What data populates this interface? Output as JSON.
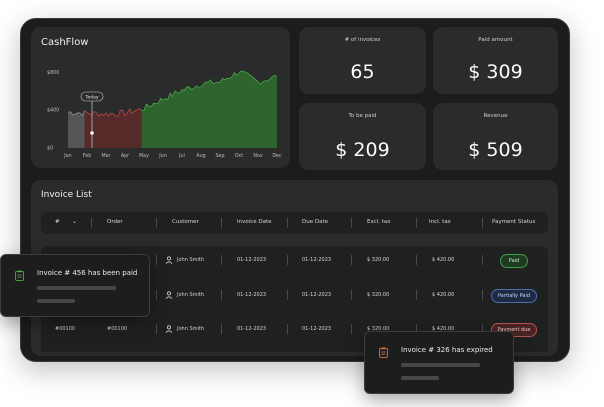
{
  "cashflow": {
    "title": "CashFlow",
    "today_label": "Today"
  },
  "stats": {
    "invoices_label": "# of invoices",
    "invoices_value": "65",
    "paid_label": "Paid amount",
    "paid_value": "$ 309",
    "tobepaid_label": "To be paid",
    "tobepaid_value": "$ 209",
    "revenue_label": "Revenue",
    "revenue_value": "$ 509"
  },
  "invoice_list": {
    "title": "Invoice List",
    "columns": [
      "#",
      "Order",
      "Customer",
      "Invoice Date",
      "Due Date",
      "Excl. tax",
      "Incl. tax",
      "Payment Status"
    ],
    "rows": [
      {
        "num": "",
        "order": "",
        "customer": "John Smith",
        "invoice_date": "01-12-2023",
        "due_date": "01-12-2023",
        "excl": "$ 320.00",
        "incl": "$ 420.00",
        "status": "Paid"
      },
      {
        "num": "",
        "order": "",
        "customer": "John Smith",
        "invoice_date": "01-12-2023",
        "due_date": "01-12-2023",
        "excl": "$ 320.00",
        "incl": "$ 420.00",
        "status": "Partially Paid"
      },
      {
        "num": "#00100",
        "order": "#00100",
        "customer": "John Smith",
        "invoice_date": "01-12-2023",
        "due_date": "01-12-2023",
        "excl": "$ 320.00",
        "incl": "$ 420.00",
        "status": "Payment due"
      }
    ]
  },
  "toasts": {
    "paid_message": "Invoice # 456 has been paid",
    "expired_message": "Invoice # 326 has expired"
  },
  "colors": {
    "accent_green": "#3f9e4a",
    "accent_red": "#c0504d",
    "card_bg": "#2a2b2b"
  },
  "chart_data": {
    "type": "area",
    "title": "CashFlow",
    "categories": [
      "Jan",
      "Feb",
      "Mar",
      "Apr",
      "May",
      "Jun",
      "Jul",
      "Aug",
      "Sep",
      "Oct",
      "Nov",
      "Dec"
    ],
    "y_ticks": [
      "$800",
      "$400",
      "$0"
    ],
    "ylim": [
      0,
      900
    ],
    "today_category": "Feb",
    "series": [
      {
        "values": [
          380,
          370,
          360,
          370,
          420,
          520,
          610,
          680,
          700,
          810,
          700,
          760
        ],
        "color_by_segment": [
          "gray",
          "red",
          "red",
          "red",
          "green",
          "green",
          "green",
          "green",
          "green",
          "green",
          "green",
          "green"
        ]
      }
    ],
    "grid": false,
    "legend": "none"
  }
}
